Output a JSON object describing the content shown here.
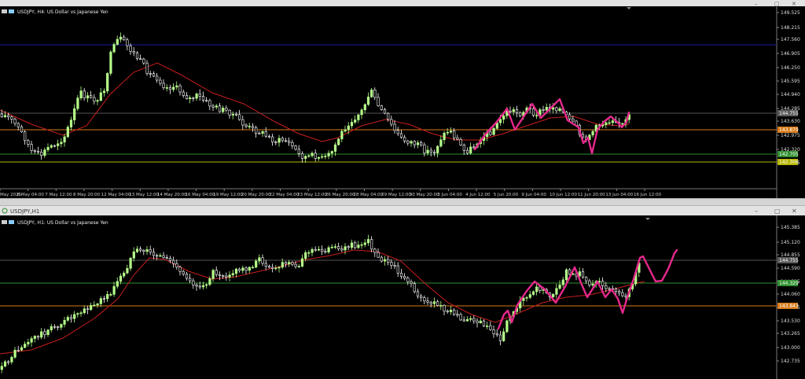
{
  "window_top": {
    "buttons": [
      "–",
      "▢",
      "✕"
    ]
  },
  "window_bottom": {
    "title": "USDJPY,H1",
    "buttons": [
      "–",
      "▢",
      "✕"
    ]
  },
  "charts": [
    {
      "title": "USDJPY, H4:  US Dollar vs Japanese Yen",
      "price_ticks": [
        "149.525",
        "148.215",
        "147.560",
        "146.905",
        "146.250",
        "145.595",
        "144.940",
        "144.285",
        "143.630",
        "142.975",
        "142.320",
        "141.665"
      ],
      "time_ticks": [
        "May 2025",
        "6 May 04:00",
        "7 May 12:00",
        "8 May 20:00",
        "12 May 04:00",
        "13 May 12:00",
        "14 May 20:00",
        "16 May 04:00",
        "19 May 12:00",
        "20 May 20:00",
        "22 May 04:00",
        "23 May 12:00",
        "26 May 20:00",
        "28 May 04:00",
        "29 May 12:00",
        "30 May 20:00",
        "3 Jun 04:00",
        "4 Jun 12:00",
        "5 Jun 20:00",
        "9 Jun 04:00",
        "10 Jun 12:00",
        "11 Jun 20:00",
        "13 Jun 04:00",
        "16 Jun 12:00"
      ],
      "price_tags": [
        {
          "text": "144.755",
          "color": "#5a5a5a"
        },
        {
          "text": "143.879",
          "color": "#d67a1a"
        },
        {
          "text": "142.705",
          "color": "#2f8f2f"
        },
        {
          "text": "142.306",
          "color": "#b5b500"
        }
      ]
    },
    {
      "title": "USDJPY, H1:  US Dollar vs Japanese Yen",
      "price_ticks": [
        "145.385",
        "145.120",
        "144.855",
        "144.590",
        "144.325",
        "144.060",
        "143.795",
        "143.530",
        "143.265",
        "143.000",
        "142.735"
      ],
      "time_ticks": [],
      "price_tags": [
        {
          "text": "144.755",
          "color": "#5a5a5a"
        },
        {
          "text": "144.329",
          "color": "#2f8f2f"
        },
        {
          "text": "143.843",
          "color": "#d67a1a"
        }
      ]
    }
  ],
  "colors": {
    "background": "#000000",
    "bull_candle": "#b6ff8a",
    "bear_candle": "#ffffff",
    "moving_average": "#c81e1e",
    "drawing": "#e6288c"
  }
}
